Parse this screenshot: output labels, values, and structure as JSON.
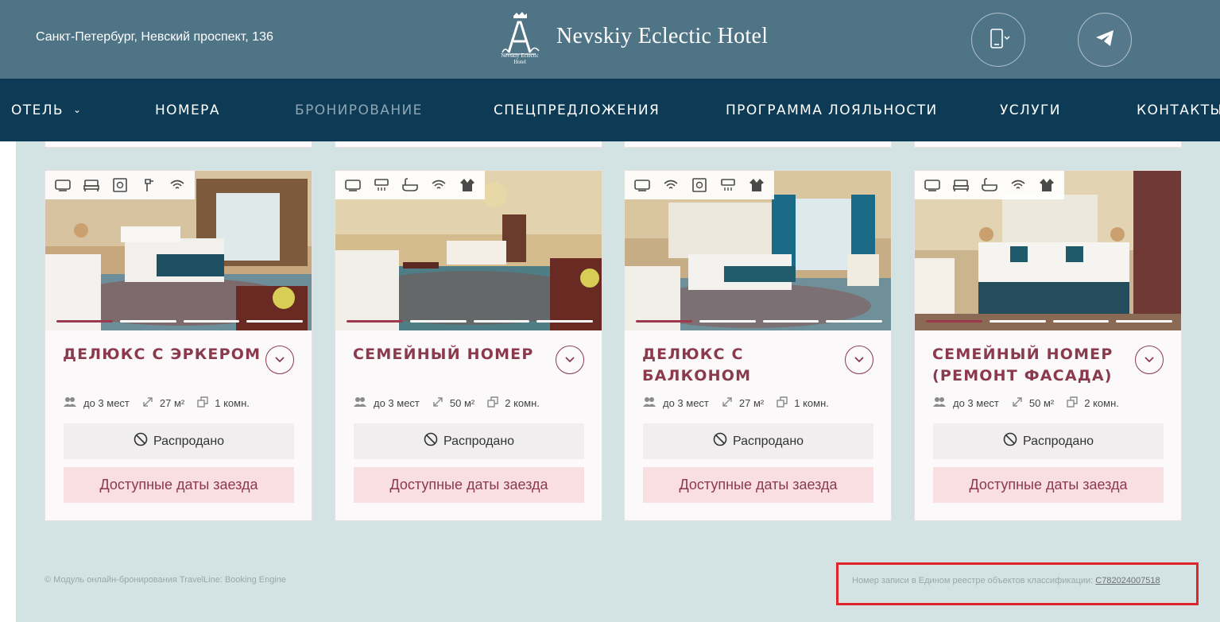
{
  "header": {
    "address": "Санкт-Петербург, Невский проспект, 136",
    "brand": "Nevskiy Eclectic Hotel",
    "logo_text": "Nevskiy Eclectic Hotel",
    "phone_icon": "phone-icon",
    "telegram_icon": "telegram-icon"
  },
  "nav": {
    "items": [
      {
        "label": "ОТЕЛЬ",
        "has_dropdown": true
      },
      {
        "label": "НОМЕРА"
      },
      {
        "label": "БРОНИРОВАНИЕ",
        "active": true
      },
      {
        "label": "СПЕЦПРЕДЛОЖЕНИЯ"
      },
      {
        "label": "ПРОГРАММА ЛОЯЛЬНОСТИ"
      },
      {
        "label": "УСЛУГИ"
      },
      {
        "label": "КОНТАКТЫ"
      }
    ]
  },
  "colors": {
    "header_bg": "#4f7486",
    "nav_bg": "#0d3a54",
    "accent": "#8b3a4e",
    "content_bg": "#d3e3e4",
    "dates_button_bg": "#f9dee2",
    "highlight_box": "#e0242a"
  },
  "rooms": [
    {
      "title": "ДЕЛЮКС С ЭРКЕРОМ",
      "amenities": [
        "tv-icon",
        "bed-icon",
        "safe-icon",
        "hairdryer-icon",
        "wifi-icon"
      ],
      "guests": "до 3 мест",
      "area": "27 м²",
      "rooms": "1 комн.",
      "status": "Распродано",
      "dates_label": "Доступные даты заезда",
      "photo_slides": 4,
      "active_slide": 1
    },
    {
      "title": "СЕМЕЙНЫЙ НОМЕР",
      "amenities": [
        "tv-icon",
        "air-conditioner-icon",
        "bath-icon",
        "wifi-icon",
        "bathrobe-icon"
      ],
      "guests": "до 3 мест",
      "area": "50 м²",
      "rooms": "2 комн.",
      "status": "Распродано",
      "dates_label": "Доступные даты заезда",
      "photo_slides": 4,
      "active_slide": 1
    },
    {
      "title": "ДЕЛЮКС С БАЛКОНОМ",
      "amenities": [
        "tv-icon",
        "wifi-icon",
        "safe-icon",
        "air-conditioner-icon",
        "bathrobe-icon"
      ],
      "guests": "до 3 мест",
      "area": "27 м²",
      "rooms": "1 комн.",
      "status": "Распродано",
      "dates_label": "Доступные даты заезда",
      "photo_slides": 4,
      "active_slide": 1
    },
    {
      "title": "СЕМЕЙНЫЙ НОМЕР (РЕМОНТ ФАСАДА)",
      "amenities": [
        "tv-icon",
        "bed-icon",
        "bath-icon",
        "wifi-icon",
        "bathrobe-icon"
      ],
      "guests": "до 3 мест",
      "area": "50 м²",
      "rooms": "2 комн.",
      "status": "Распродано",
      "dates_label": "Доступные даты заезда",
      "photo_slides": 4,
      "active_slide": 1
    }
  ],
  "footer": {
    "copyright": "© Модуль онлайн-бронирования TravelLine: Booking Engine",
    "registry_text": "Номер записи в Едином реестре объектов классификации:",
    "registry_number": "C782024007518"
  }
}
